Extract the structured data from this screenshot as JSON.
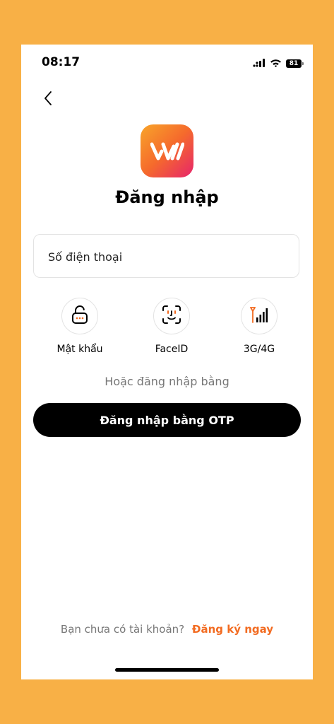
{
  "status_bar": {
    "time": "08:17",
    "battery": "81"
  },
  "login": {
    "title": "Đăng nhập",
    "phone_placeholder": "Số điện thoại",
    "options": [
      {
        "label": "Mật khẩu",
        "icon": "lock-icon"
      },
      {
        "label": "FaceID",
        "icon": "face-id-icon"
      },
      {
        "label": "3G/4G",
        "icon": "signal-3g-4g-icon"
      }
    ],
    "or_text": "Hoặc đăng nhập bằng",
    "otp_button": "Đăng nhập bằng OTP"
  },
  "footer": {
    "register_prompt": "Bạn chưa có tài khoản?",
    "register_link": "Đăng ký ngay"
  },
  "colors": {
    "background": "#F8B046",
    "accent": "#F26B21",
    "logo_gradient": [
      "#F8A52A",
      "#F56A2C",
      "#E7246B"
    ]
  }
}
